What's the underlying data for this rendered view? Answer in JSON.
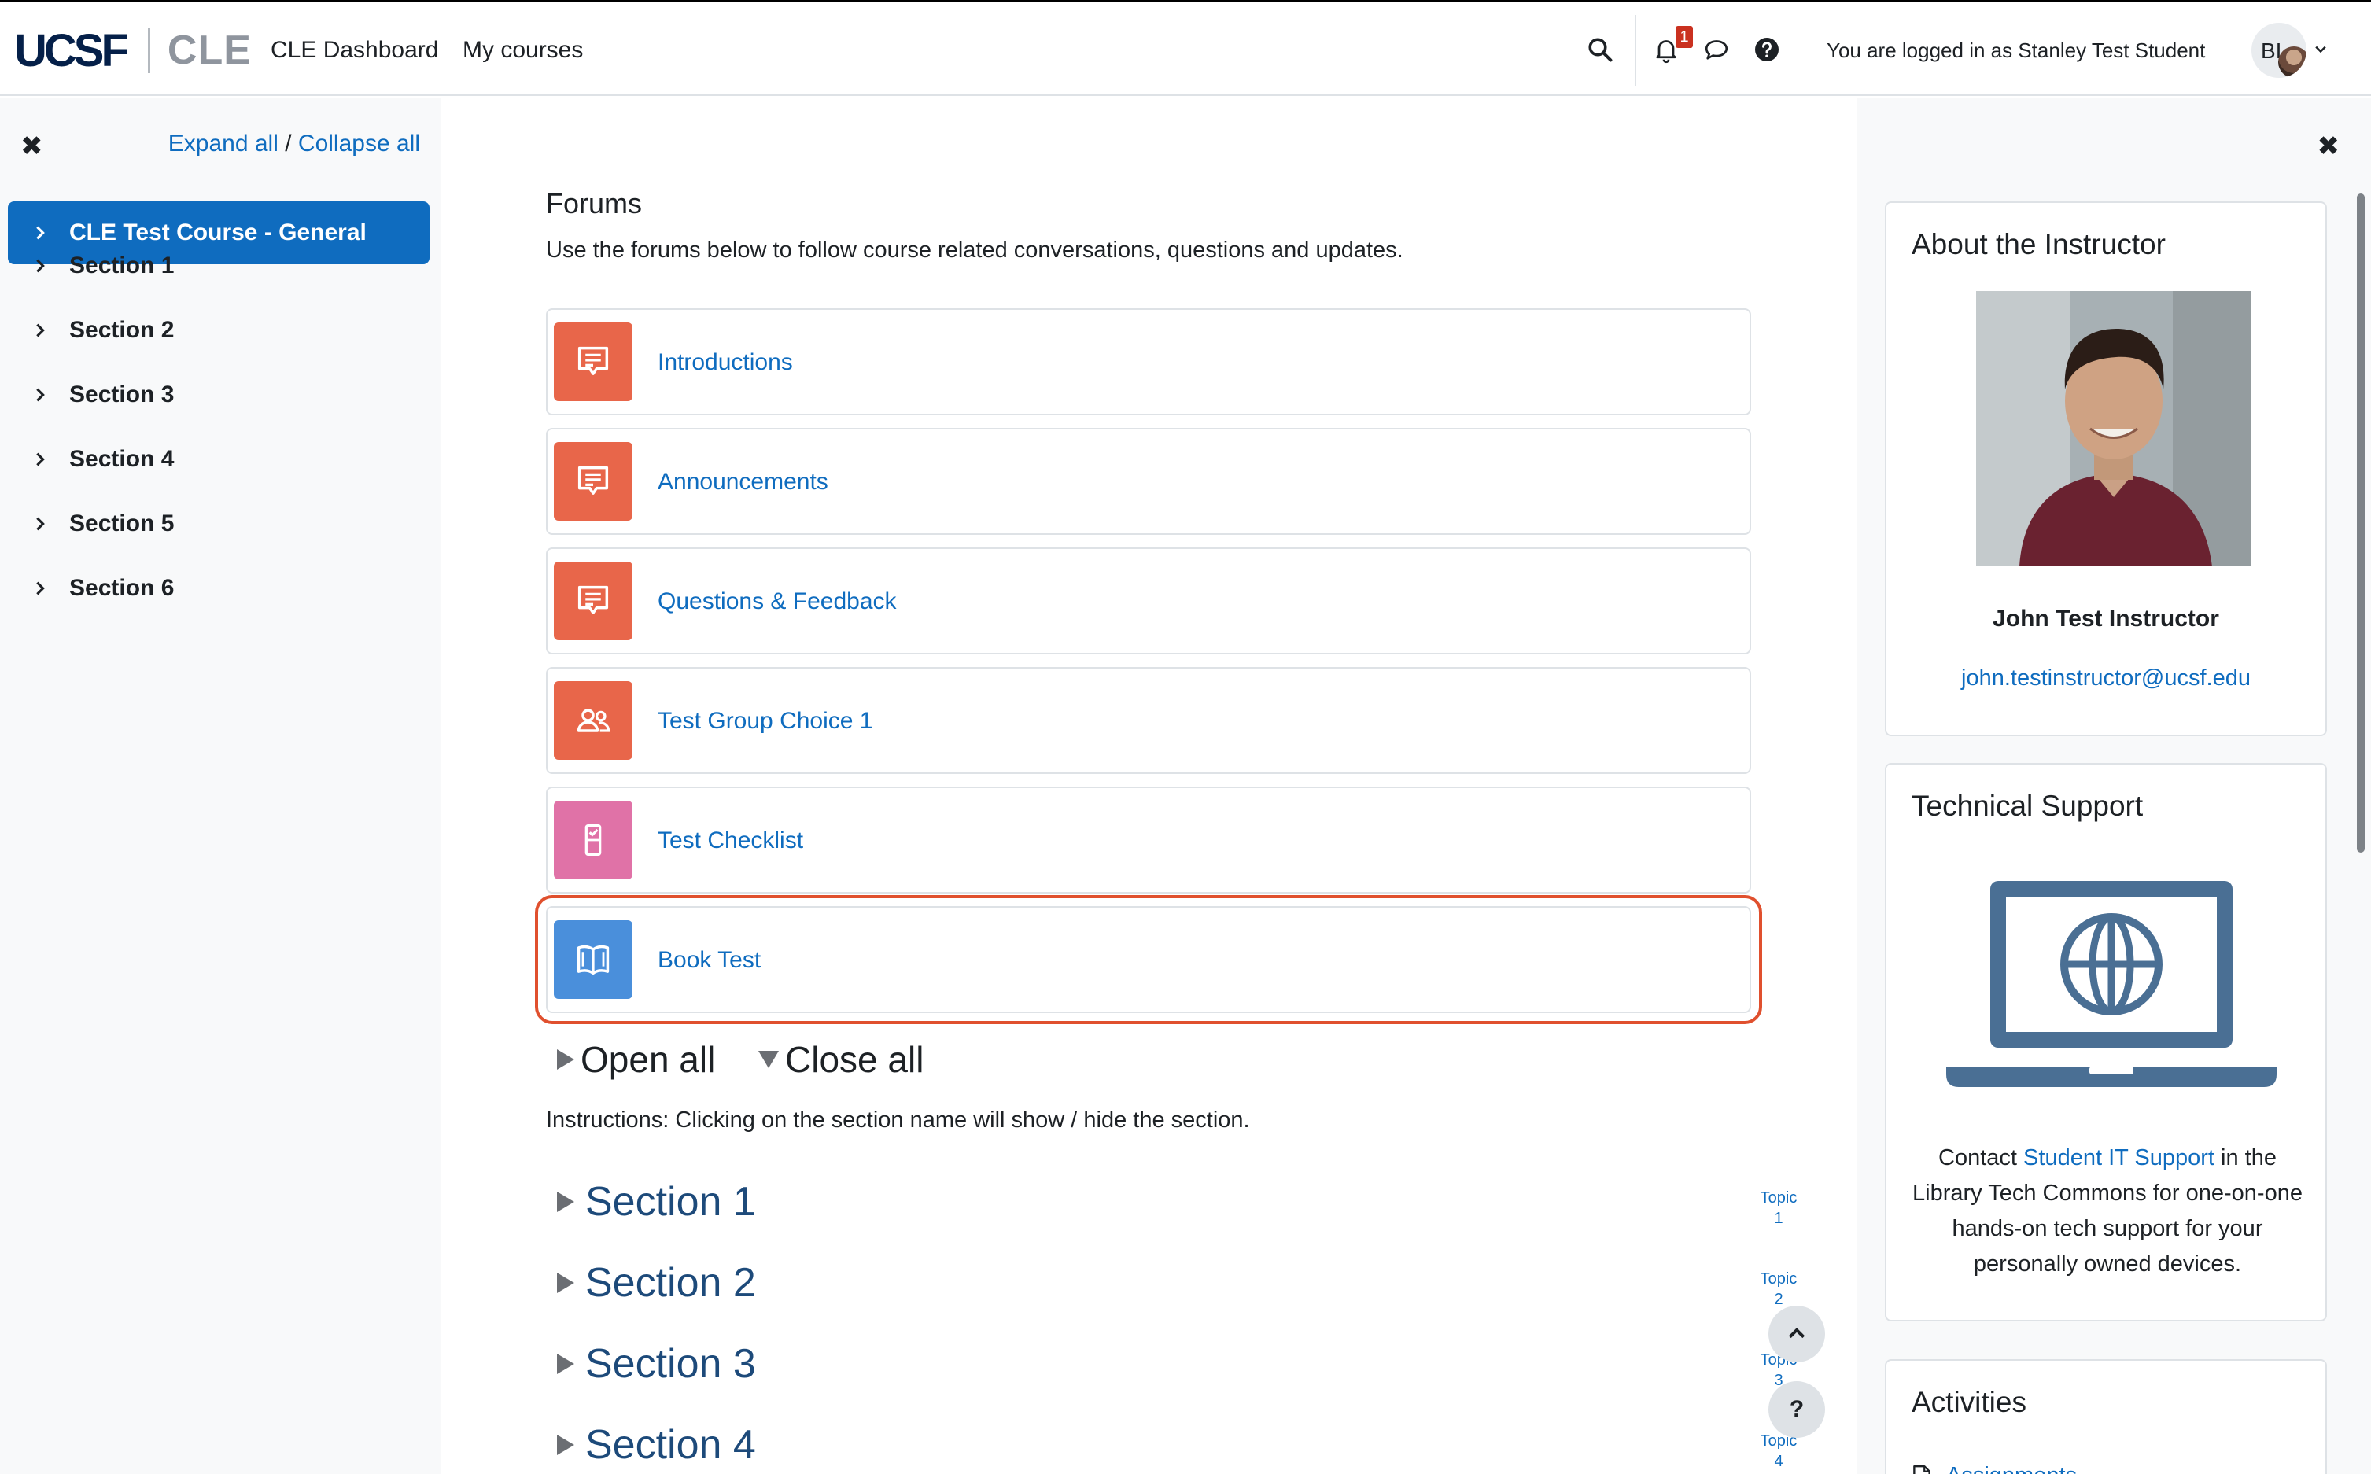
{
  "navbar": {
    "logo_primary": "UCSF",
    "logo_secondary": "CLE",
    "links": [
      {
        "label": "CLE Dashboard"
      },
      {
        "label": "My courses"
      }
    ],
    "notification_count": "1",
    "login_text": "You are logged in as Stanley Test Student",
    "avatar_initials": "BI"
  },
  "left_drawer": {
    "expand_all": "Expand all",
    "separator": "/",
    "collapse_all": "Collapse all",
    "items": [
      {
        "label": "CLE Test Course - General",
        "active": true
      },
      {
        "label": "Section 1"
      },
      {
        "label": "Section 2"
      },
      {
        "label": "Section 3"
      },
      {
        "label": "Section 4"
      },
      {
        "label": "Section 5"
      },
      {
        "label": "Section 6"
      }
    ]
  },
  "main": {
    "forums_title": "Forums",
    "forums_description": "Use the forums below to follow course related conversations, questions and updates.",
    "activities": [
      {
        "name": "Introductions",
        "icon": "forum-icon",
        "color": "#e8664a"
      },
      {
        "name": "Announcements",
        "icon": "forum-icon",
        "color": "#e8664a"
      },
      {
        "name": "Questions & Feedback",
        "icon": "forum-icon",
        "color": "#e8664a"
      },
      {
        "name": "Test Group Choice 1",
        "icon": "group-choice-icon",
        "color": "#e8664a"
      },
      {
        "name": "Test Checklist",
        "icon": "checklist-icon",
        "color": "#e072a7"
      },
      {
        "name": "Book Test",
        "icon": "book-icon",
        "color": "#4a8fdb",
        "highlighted": true
      }
    ],
    "open_all": "Open all",
    "close_all": "Close all",
    "instructions": "Instructions: Clicking on the section name will show / hide the section.",
    "sections": [
      {
        "label": "Section 1",
        "topic_word": "Topic",
        "topic_num": "1"
      },
      {
        "label": "Section 2",
        "topic_word": "Topic",
        "topic_num": "2"
      },
      {
        "label": "Section 3",
        "topic_word": "Topic",
        "topic_num": "3"
      },
      {
        "label": "Section 4",
        "topic_word": "Topic",
        "topic_num": "4"
      }
    ]
  },
  "right_drawer": {
    "instructor_block": {
      "title": "About the Instructor",
      "name": "John Test Instructor",
      "email": "john.testinstructor@ucsf.edu"
    },
    "support_block": {
      "title": "Technical Support",
      "text_before": "Contact ",
      "link": "Student IT Support",
      "text_after": " in the Library Tech Commons for one-on-one hands-on tech support for your personally owned devices."
    },
    "activities_block": {
      "title": "Activities",
      "first_link": "Assignments"
    }
  },
  "colors": {
    "accent": "#0f6cbf",
    "forum_orange": "#e8664a",
    "checklist_pink": "#e072a7",
    "book_blue": "#4a8fdb",
    "highlight_red": "#e0502e"
  }
}
